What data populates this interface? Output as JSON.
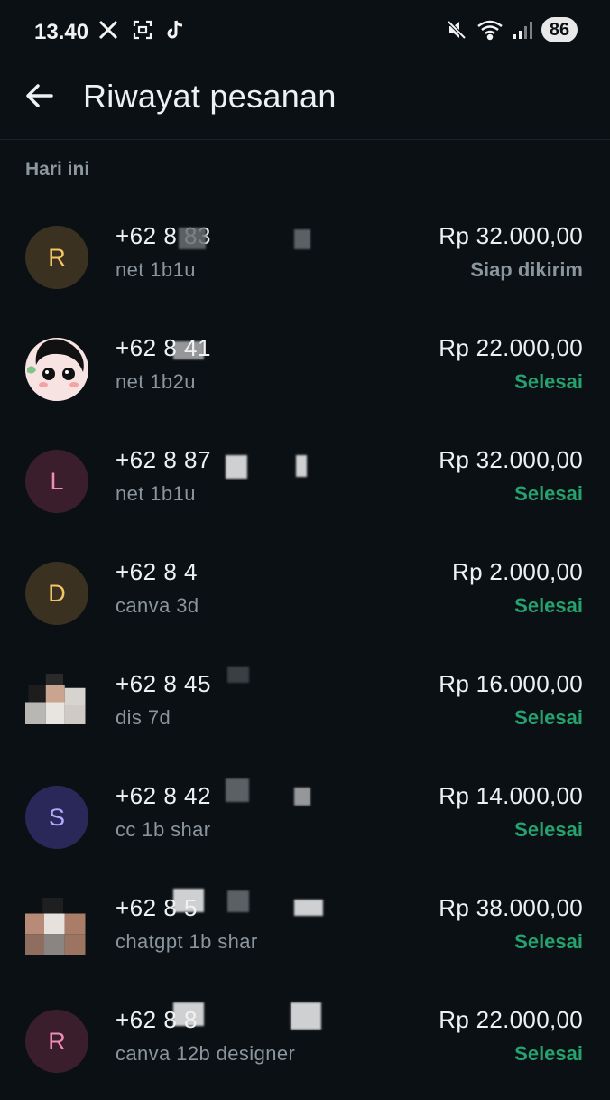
{
  "status_bar": {
    "time": "13.40",
    "left_icons": [
      "x-logo-icon",
      "screenshot-icon",
      "tiktok-icon"
    ],
    "right_icons": [
      "mute-vibrate-icon",
      "wifi-icon",
      "signal-icon"
    ],
    "battery": "86"
  },
  "header": {
    "back_icon": "arrow-left-icon",
    "title": "Riwayat pesanan"
  },
  "section": {
    "label": "Hari ini"
  },
  "colors": {
    "background": "#0b1015",
    "done": "#25a26e",
    "muted": "#8a959c"
  },
  "orders": [
    {
      "initial": "R",
      "avatar_bg": "#3b3120",
      "avatar_fg": "#f3c565",
      "phone": "+62 8 83",
      "product": "net 1b1u",
      "amount": "Rp 32.000,00",
      "status": "Siap dikirim"
    },
    {
      "initial": "",
      "avatar_bg": "#f4d9d9",
      "avatar_fg": "#000000",
      "phone": "+62 8 41",
      "product": "net 1b2u",
      "amount": "Rp 22.000,00",
      "status": "Selesai"
    },
    {
      "initial": "L",
      "avatar_bg": "#3a1e2c",
      "avatar_fg": "#f08cb5",
      "phone": "+62 8 87",
      "product": "net 1b1u",
      "amount": "Rp 32.000,00",
      "status": "Selesai"
    },
    {
      "initial": "D",
      "avatar_bg": "#3b3120",
      "avatar_fg": "#f3c565",
      "phone": "+62 8 4",
      "product": "canva 3d",
      "amount": "Rp 2.000,00",
      "status": "Selesai"
    },
    {
      "initial": "",
      "avatar_bg": "#0b1015",
      "avatar_fg": "#000000",
      "phone": "+62 8 45",
      "product": "dis 7d",
      "amount": "Rp 16.000,00",
      "status": "Selesai"
    },
    {
      "initial": "S",
      "avatar_bg": "#2a2858",
      "avatar_fg": "#b2a8ff",
      "phone": "+62 8 42",
      "product": "cc 1b shar",
      "amount": "Rp 14.000,00",
      "status": "Selesai"
    },
    {
      "initial": "",
      "avatar_bg": "#0b1015",
      "avatar_fg": "#000000",
      "phone": "+62 8 5",
      "product": "chatgpt 1b shar",
      "amount": "Rp 38.000,00",
      "status": "Selesai"
    },
    {
      "initial": "R",
      "avatar_bg": "#3a1e2c",
      "avatar_fg": "#f08cb5",
      "phone": "+62 8 8",
      "product": "canva 12b designer",
      "amount": "Rp 22.000,00",
      "status": "Selesai"
    }
  ]
}
